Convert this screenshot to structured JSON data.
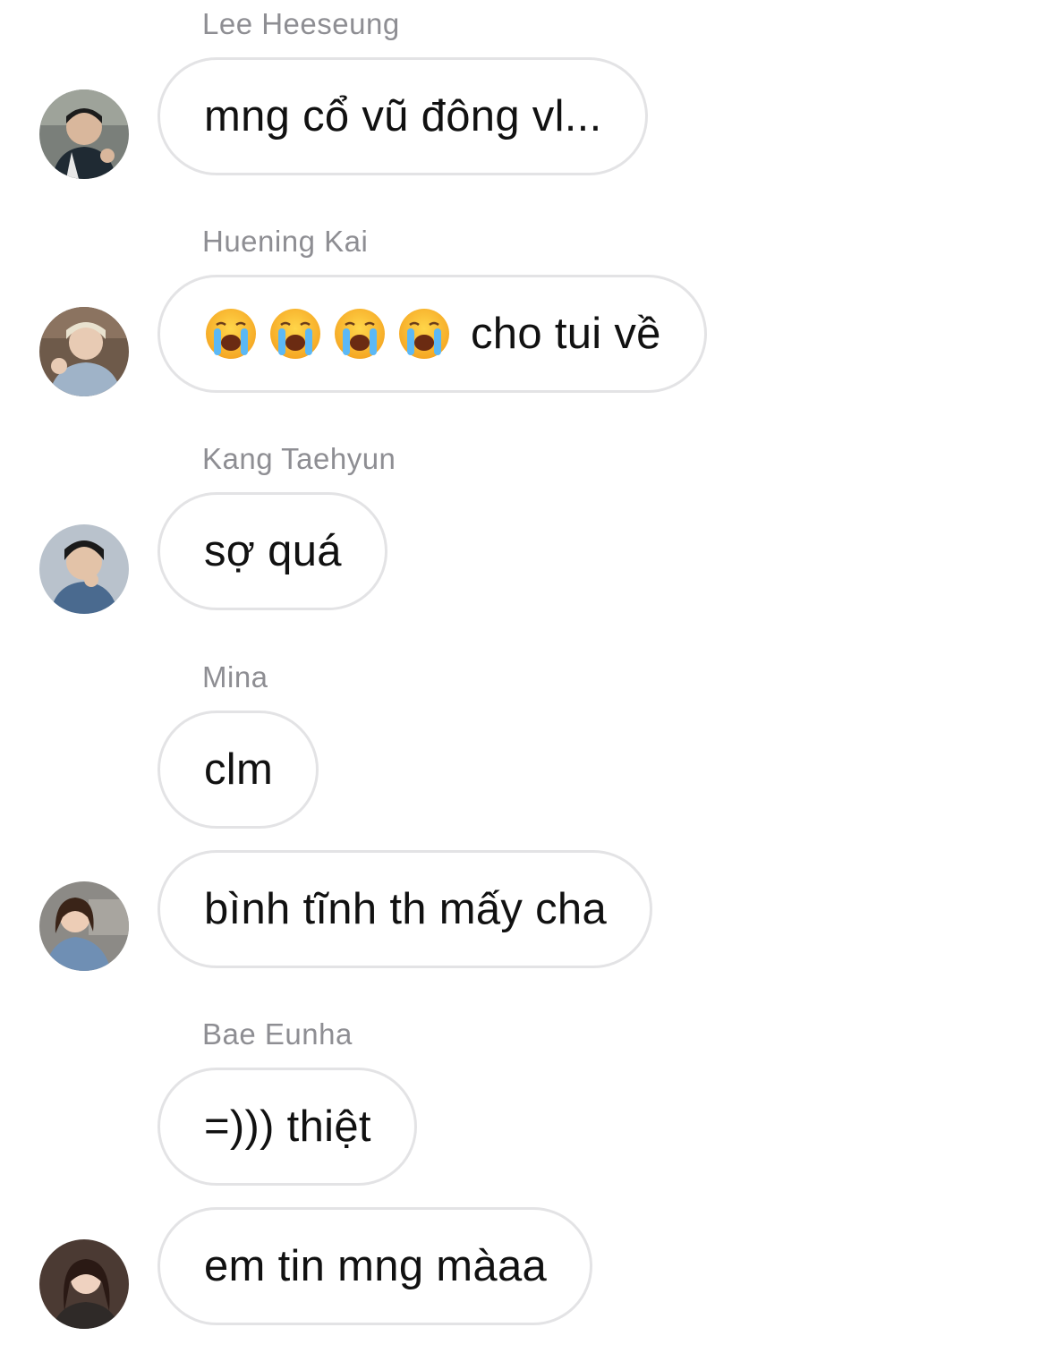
{
  "messages": [
    {
      "sender": "Lee Heeseung",
      "text": "mng cổ vũ đông vl...",
      "avatar": "avatar-photo"
    },
    {
      "sender": "Huening Kai",
      "emojis": [
        "loudly-crying-face",
        "loudly-crying-face",
        "loudly-crying-face",
        "loudly-crying-face"
      ],
      "text": "cho tui về",
      "avatar": "avatar-photo"
    },
    {
      "sender": "Kang Taehyun",
      "text": "sợ quá",
      "avatar": "avatar-photo"
    },
    {
      "sender": "Mina",
      "text": "clm"
    },
    {
      "text": "bình tĩnh th mấy cha",
      "avatar": "avatar-photo"
    },
    {
      "sender": "Bae Eunha",
      "text": "=))) thiệt"
    },
    {
      "text": "em tin mng màaa",
      "avatar": "avatar-photo"
    }
  ],
  "colors": {
    "sender_name": "#8e8e93",
    "bubble_border": "#e3e3e5",
    "bubble_bg": "#ffffff",
    "message_text": "#111111"
  }
}
